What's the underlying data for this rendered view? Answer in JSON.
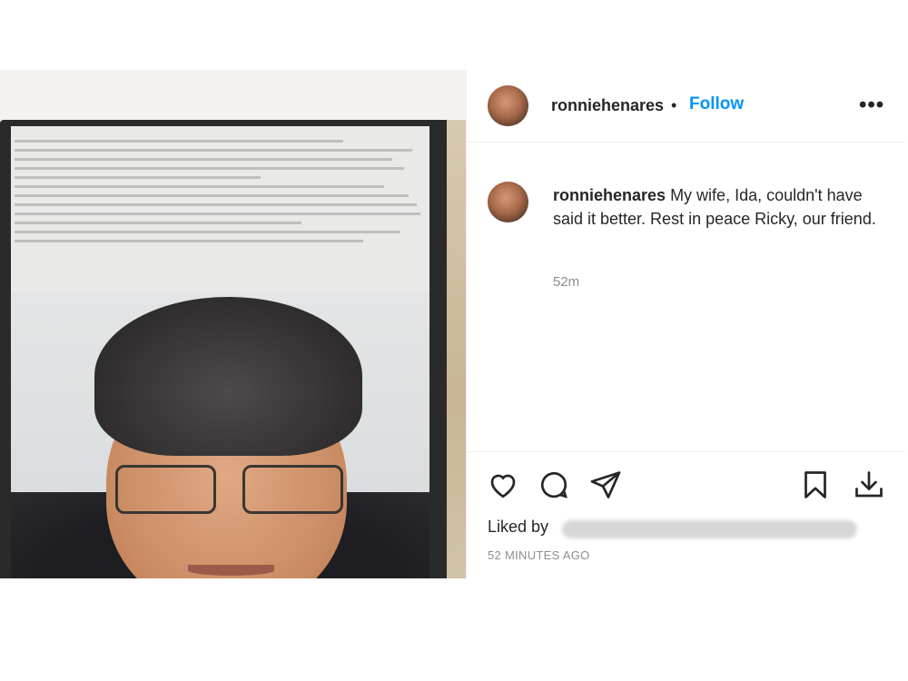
{
  "post": {
    "username": "ronniehenares",
    "separator": "•",
    "follow_label": "Follow",
    "more_icon": "more-horizontal-icon",
    "caption_username": "ronniehenares",
    "caption_text": "My wife, Ida, couldn't have said it better. Rest in peace Ricky, our friend.",
    "caption_time": "52m",
    "liked_by_label": "Liked by",
    "timestamp": "52 MINUTES AGO"
  },
  "icons": {
    "like": "heart-icon",
    "comment": "comment-icon",
    "share": "send-icon",
    "save": "bookmark-icon",
    "download": "download-icon"
  },
  "colors": {
    "accent": "#0095f6",
    "muted": "#8e8e8e",
    "text": "#262626"
  }
}
